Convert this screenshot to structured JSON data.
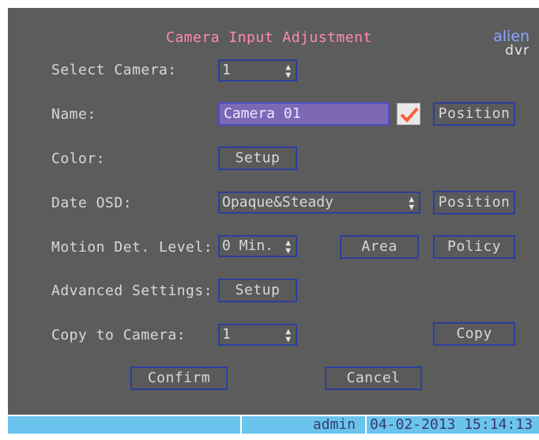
{
  "title": "Camera Input Adjustment",
  "logo": {
    "line1": "alien",
    "line2": "dvr"
  },
  "select_camera": {
    "label": "Select Camera:",
    "value": "1"
  },
  "name": {
    "label": "Name:",
    "value": "Camera 01",
    "checked": true,
    "position_button": "Position"
  },
  "color": {
    "label": "Color:",
    "setup_button": "Setup"
  },
  "date_osd": {
    "label": "Date OSD:",
    "value": "Opaque&Steady",
    "position_button": "Position"
  },
  "motion": {
    "label": "Motion Det. Level:",
    "value": "0 Min.",
    "area_button": "Area",
    "policy_button": "Policy"
  },
  "advanced": {
    "label": "Advanced Settings:",
    "setup_button": "Setup"
  },
  "copy": {
    "label": "Copy to Camera:",
    "value": "1",
    "copy_button": "Copy"
  },
  "footer": {
    "confirm": "Confirm",
    "cancel": "Cancel"
  },
  "status": {
    "user": "admin",
    "datetime": "04-02-2013 15:14:13"
  },
  "colors": {
    "panel": "#5c5c5c",
    "border": "#2b3f9c",
    "title": "#ff8ab0",
    "status": "#6ac4ee",
    "check": "#ff5a3c"
  }
}
